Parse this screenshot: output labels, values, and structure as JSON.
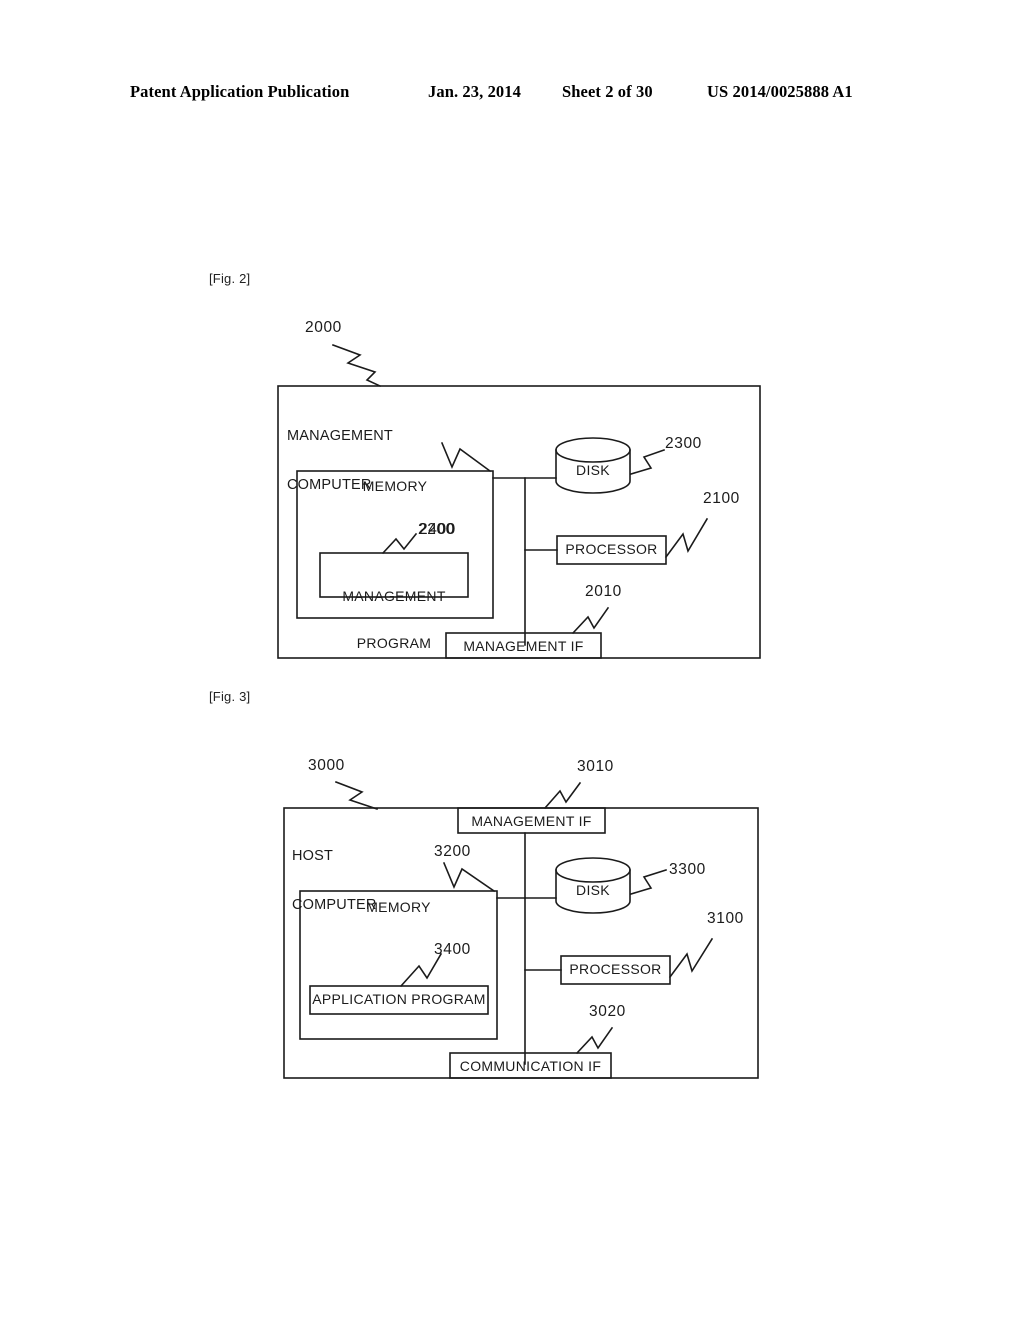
{
  "header": {
    "publication": "Patent Application Publication",
    "date": "Jan. 23, 2014",
    "sheet": "Sheet 2 of 30",
    "patent_number": "US 2014/0025888 A1"
  },
  "figures": [
    {
      "label": "[Fig. 2]",
      "outer_title_line1": "MANAGEMENT",
      "outer_title_line2": "COMPUTER",
      "outer_ref": "2000",
      "memory_label": "MEMORY",
      "memory_ref": "2200",
      "program_line1": "MANAGEMENT",
      "program_line2": "PROGRAM",
      "program_ref": "2400",
      "disk_label": "DISK",
      "disk_ref": "2300",
      "processor_label": "PROCESSOR",
      "processor_ref": "2100",
      "interface_label": "MANAGEMENT IF",
      "interface_ref": "2010"
    },
    {
      "label": "[Fig. 3]",
      "outer_title_line1": "HOST",
      "outer_title_line2": "COMPUTER",
      "outer_ref": "3000",
      "top_interface_label": "MANAGEMENT IF",
      "top_interface_ref": "3010",
      "memory_label": "MEMORY",
      "memory_ref": "3200",
      "program_label": "APPLICATION PROGRAM",
      "program_ref": "3400",
      "disk_label": "DISK",
      "disk_ref": "3300",
      "processor_label": "PROCESSOR",
      "processor_ref": "3100",
      "interface_label": "COMMUNICATION IF",
      "interface_ref": "3020"
    }
  ],
  "colors": {
    "ink": "#1b1b1b",
    "paper": "#ffffff"
  }
}
